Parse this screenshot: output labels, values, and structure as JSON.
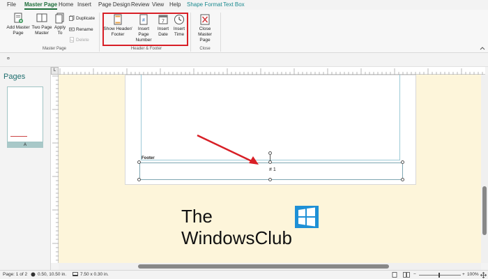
{
  "tabs": [
    "File",
    "Master Page",
    "Home",
    "Insert",
    "Page Design",
    "Review",
    "View",
    "Help",
    "Shape Format",
    "Text Box"
  ],
  "ribbon": {
    "add_master_page": "Add Master Page",
    "two_page_master": "Two Page Master",
    "apply_to": "Apply To",
    "duplicate": "Duplicate",
    "rename": "Rename",
    "delete": "Delete",
    "group_master_page": "Master Page",
    "show_header_footer": "Show Header/ Footer",
    "insert_page_number": "Insert Page Number",
    "insert_date": "Insert Date",
    "insert_time": "Insert Time",
    "group_header_footer": "Header & Footer",
    "close_master_page": "Close Master Page",
    "group_close": "Close"
  },
  "formula_bar": "¤",
  "pages_pane": {
    "title": "Pages",
    "thumb_label": "A"
  },
  "ruler_corner": "L",
  "document": {
    "footer_label": "Footer",
    "footer_text": "# 1"
  },
  "logo": {
    "line1": "The",
    "line2": "WindowsClub"
  },
  "status": {
    "page": "Page: 1 of 2",
    "position": "0.50, 10.50 in.",
    "size": "7.50 x 0.30 in.",
    "zoom": "100%"
  },
  "colors": {
    "accent": "#1e6e3a",
    "highlight_box": "#d81f26",
    "arrow": "#d81f26",
    "workspace": "#fdf5da",
    "logo_blue": "#1e90d6"
  }
}
